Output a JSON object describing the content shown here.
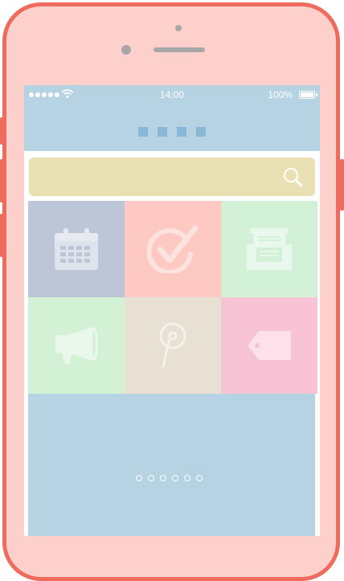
{
  "statusbar": {
    "signal_dots": 5,
    "time": "14:00",
    "battery_text": "100%",
    "battery_level": 1.0
  },
  "navbar": {
    "page_indicator_count": 4
  },
  "search": {
    "icon": "search-icon"
  },
  "tiles": [
    {
      "icon": "calendar-icon",
      "color": "#bcc6d6"
    },
    {
      "icon": "check-circle-icon",
      "color": "#fdc9c2"
    },
    {
      "icon": "archive-drawer-icon",
      "color": "#d3f1d7"
    },
    {
      "icon": "megaphone-icon",
      "color": "#d2f1d5"
    },
    {
      "icon": "pin-icon",
      "color": "#e9e0d4"
    },
    {
      "icon": "tag-icon",
      "color": "#f9c3d6"
    }
  ],
  "banner": {
    "page_count": 6
  },
  "colors": {
    "phone_frame": "#ee6b5d",
    "phone_body": "#fdd0cb",
    "statusbar": "#b6d3e3",
    "search_bar": "#e9e0b3"
  }
}
